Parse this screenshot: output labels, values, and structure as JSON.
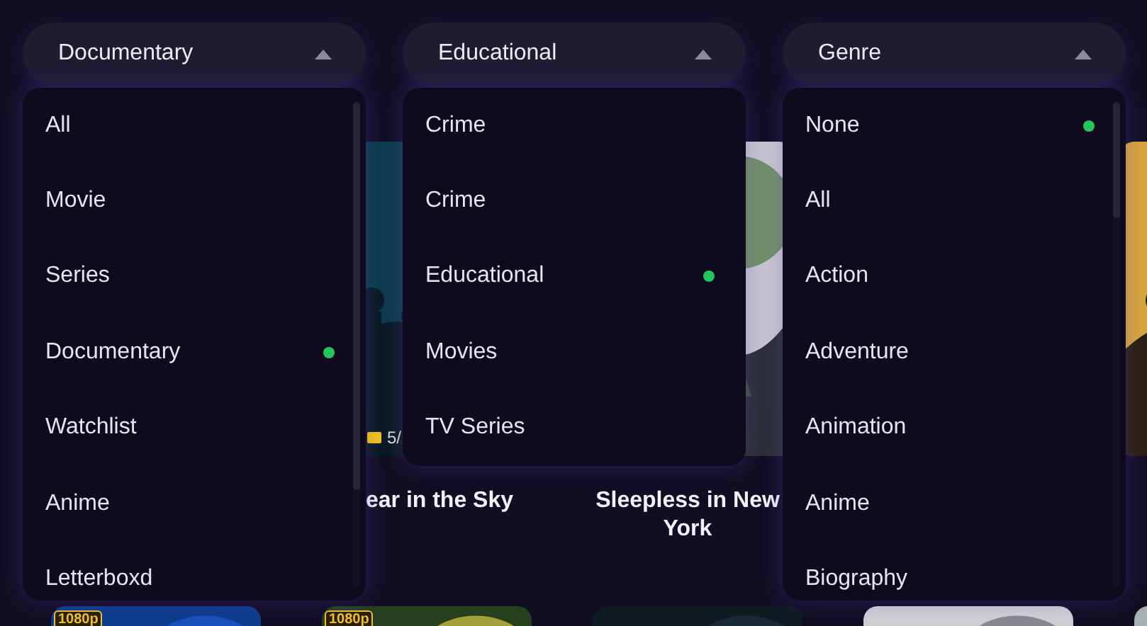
{
  "dropdowns": [
    {
      "label": "Documentary",
      "expanded": true,
      "options": [
        {
          "label": "All",
          "selected": false
        },
        {
          "label": "Movie",
          "selected": false
        },
        {
          "label": "Series",
          "selected": false
        },
        {
          "label": "Documentary",
          "selected": true
        },
        {
          "label": "Watchlist",
          "selected": false
        },
        {
          "label": "Anime",
          "selected": false
        },
        {
          "label": "Letterboxd",
          "selected": false
        }
      ]
    },
    {
      "label": "Educational",
      "expanded": true,
      "options": [
        {
          "label": "Crime",
          "selected": false
        },
        {
          "label": "Crime",
          "selected": false
        },
        {
          "label": "Educational",
          "selected": true
        },
        {
          "label": "Movies",
          "selected": false
        },
        {
          "label": "TV Series",
          "selected": false
        }
      ]
    },
    {
      "label": "Genre",
      "expanded": true,
      "options": [
        {
          "label": "None",
          "selected": true
        },
        {
          "label": "All",
          "selected": false
        },
        {
          "label": "Action",
          "selected": false
        },
        {
          "label": "Adventure",
          "selected": false
        },
        {
          "label": "Animation",
          "selected": false
        },
        {
          "label": "Anime",
          "selected": false
        },
        {
          "label": "Biography",
          "selected": false
        }
      ]
    }
  ],
  "cards": [
    {
      "kind": "picture",
      "title": "ear in the Sky",
      "rating": "5/"
    },
    {
      "kind": "picture",
      "title": "Sleepless in New York"
    },
    {
      "kind": "picture"
    }
  ],
  "more_cards": [
    {
      "kind": "picture",
      "badge": "1080p"
    },
    {
      "kind": "picture",
      "badge": "1080p"
    },
    {
      "kind": "picture"
    },
    {
      "kind": "picture"
    },
    {
      "kind": "picture"
    }
  ]
}
